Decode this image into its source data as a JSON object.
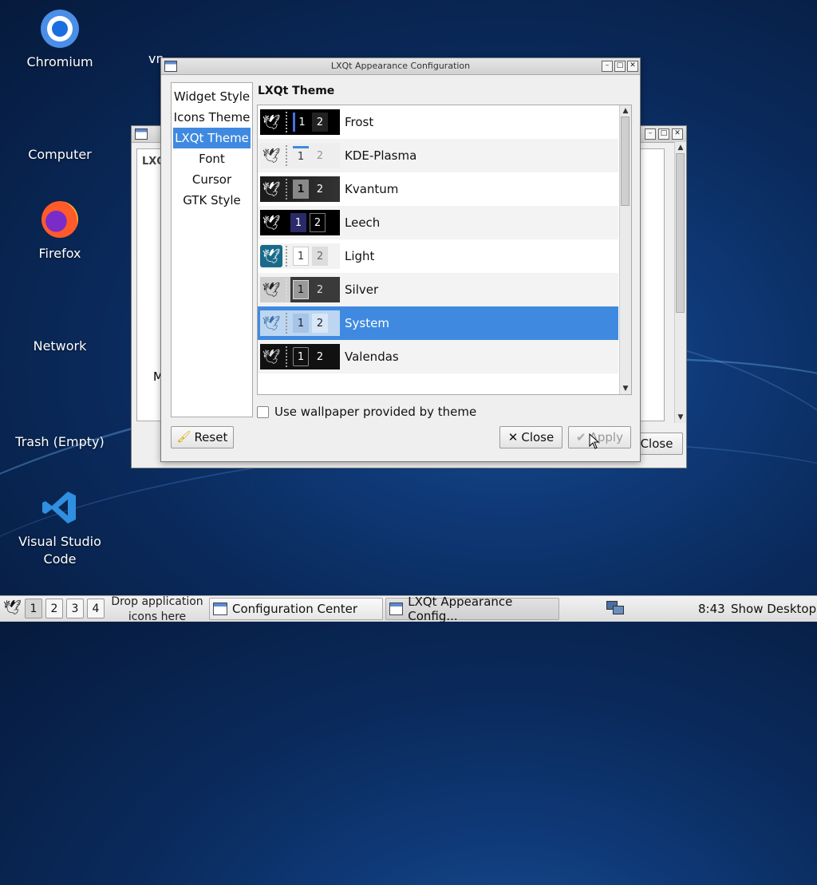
{
  "desktop": {
    "icons": [
      {
        "label": "Chromium"
      },
      {
        "label": "Computer"
      },
      {
        "label": "Firefox"
      },
      {
        "label": "Network"
      },
      {
        "label": "Trash (Empty)"
      },
      {
        "label": "Visual Studio Code"
      }
    ],
    "partial_label": "vn"
  },
  "back_window": {
    "tab_label": "LXQ",
    "partial_text": "M",
    "close_label": "Close"
  },
  "dialog": {
    "title": "LXQt Appearance Configuration",
    "nav_items": [
      {
        "label": "Widget Style"
      },
      {
        "label": "Icons Theme"
      },
      {
        "label": "LXQt Theme"
      },
      {
        "label": "Font"
      },
      {
        "label": "Cursor"
      },
      {
        "label": "GTK Style"
      }
    ],
    "active_nav_index": 2,
    "section_title": "LXQt Theme",
    "themes": [
      {
        "name": "Frost",
        "n1": "1",
        "n2": "2"
      },
      {
        "name": "KDE-Plasma",
        "n1": "1",
        "n2": "2"
      },
      {
        "name": "Kvantum",
        "n1": "1",
        "n2": "2"
      },
      {
        "name": "Leech",
        "n1": "1",
        "n2": "2"
      },
      {
        "name": "Light",
        "n1": "1",
        "n2": "2"
      },
      {
        "name": "Silver",
        "n1": "1",
        "n2": "2"
      },
      {
        "name": "System",
        "n1": "1",
        "n2": "2"
      },
      {
        "name": "Valendas",
        "n1": "1",
        "n2": "2"
      }
    ],
    "selected_theme_index": 6,
    "wallpaper_checkbox_label": "Use wallpaper provided by theme",
    "wallpaper_checked": false,
    "reset_label": "Reset",
    "close_label": "Close",
    "apply_label": "Apply"
  },
  "taskbar": {
    "desktops": [
      "1",
      "2",
      "3",
      "4"
    ],
    "active_desktop_index": 0,
    "quicklaunch_hint": "Drop application icons here",
    "tasks": [
      {
        "label": "Configuration Center"
      },
      {
        "label": "LXQt Appearance Config..."
      }
    ],
    "clock": "8:43",
    "show_desktop_label": "Show Desktop"
  },
  "colors": {
    "accent": "#3f8ae0",
    "desktop_bg": "#0f3a78"
  }
}
